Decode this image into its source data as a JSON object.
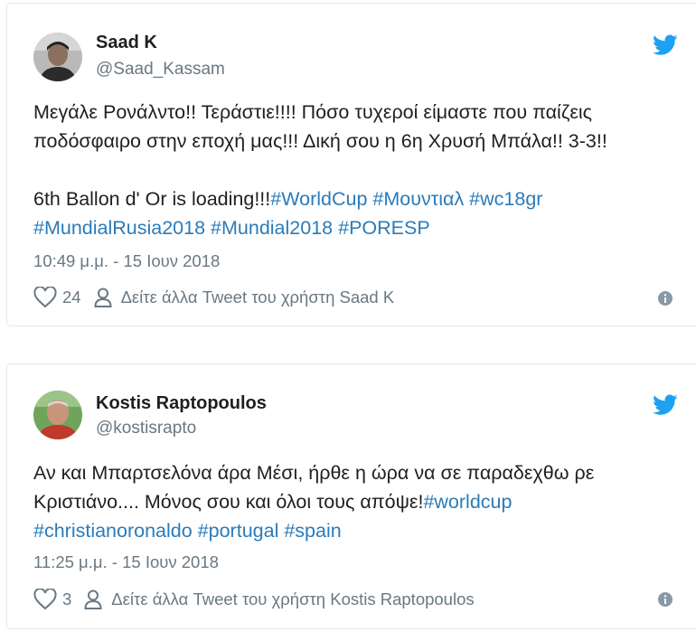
{
  "tweets": [
    {
      "name": "Saad K",
      "handle": "@Saad_Kassam",
      "line1": "Μεγάλε Ρονάλντο!! Τεράστιε!!!! Πόσο τυχεροί είμαστε που παίζεις",
      "line2": "ποδόσφαιρο στην εποχή μας!!! Δική σου η 6η Χρυσή Μπάλα!! 3-3!!",
      "line3_text": "6th Ballon d' Or is loading!!!",
      "hashtags_a": [
        "#WorldCup",
        "#Μουντιαλ",
        "#wc18gr"
      ],
      "hashtags_b": [
        "#MundialRusia2018",
        "#Mundial2018",
        "#PORESP"
      ],
      "timestamp": "10:49 μ.μ. - 15 Ιουν 2018",
      "likes": "24",
      "more_link": "Δείτε άλλα Tweet του χρήστη Saad K"
    },
    {
      "name": "Kostis Raptopoulos",
      "handle": "@kostisrapto",
      "line1": "Αν και Μπαρτσελόνα άρα Μέσι, ήρθε η ώρα να σε παραδεχθω ρε",
      "line2_text": "Κριστιάνο.... Μόνος σου και όλοι τους απόψε!",
      "line2_tag": "#worldcup",
      "hashtags_b": [
        "#christianoronaldo",
        "#portugal",
        "#spain"
      ],
      "timestamp": "11:25 μ.μ. - 15 Ιουν 2018",
      "likes": "3",
      "more_link": "Δείτε άλλα Tweet του χρήστη Kostis Raptopoulos"
    }
  ],
  "colors": {
    "link": "#2b7bb9",
    "twitter_blue": "#1da1f2",
    "muted": "#697882",
    "text": "#1c2022",
    "border": "#e1e8ed"
  },
  "icons": [
    "avatar",
    "twitter-bird-icon",
    "heart-icon",
    "person-icon",
    "info-icon"
  ]
}
